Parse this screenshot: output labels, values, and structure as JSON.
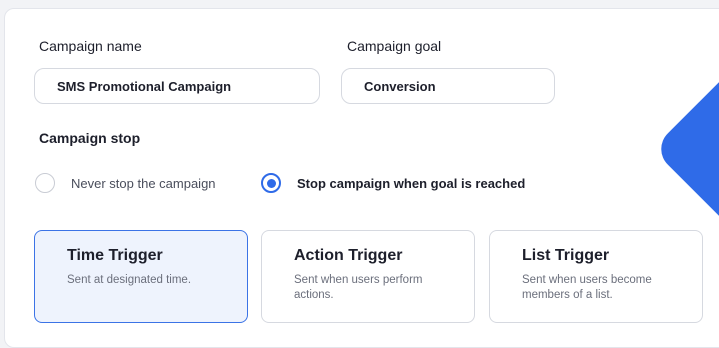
{
  "form": {
    "campaign_name_label": "Campaign name",
    "campaign_name_value": "SMS Promotional Campaign",
    "campaign_goal_label": "Campaign goal",
    "campaign_goal_value": "Conversion",
    "campaign_stop_label": "Campaign stop"
  },
  "stop_options": [
    {
      "label": "Never stop the campaign",
      "selected": false
    },
    {
      "label": "Stop campaign when goal is reached",
      "selected": true
    }
  ],
  "triggers": [
    {
      "title": "Time Trigger",
      "description": "Sent at designated time.",
      "selected": true
    },
    {
      "title": "Action Trigger",
      "description": "Sent when users perform actions.",
      "selected": false
    },
    {
      "title": "List Trigger",
      "description": "Sent when users become members of a list.",
      "selected": false
    }
  ],
  "colors": {
    "accent": "#2f6be8",
    "selected_card_bg": "#eef3fd",
    "text_primary": "#1d1f2b",
    "text_secondary": "#6b6f7c"
  }
}
